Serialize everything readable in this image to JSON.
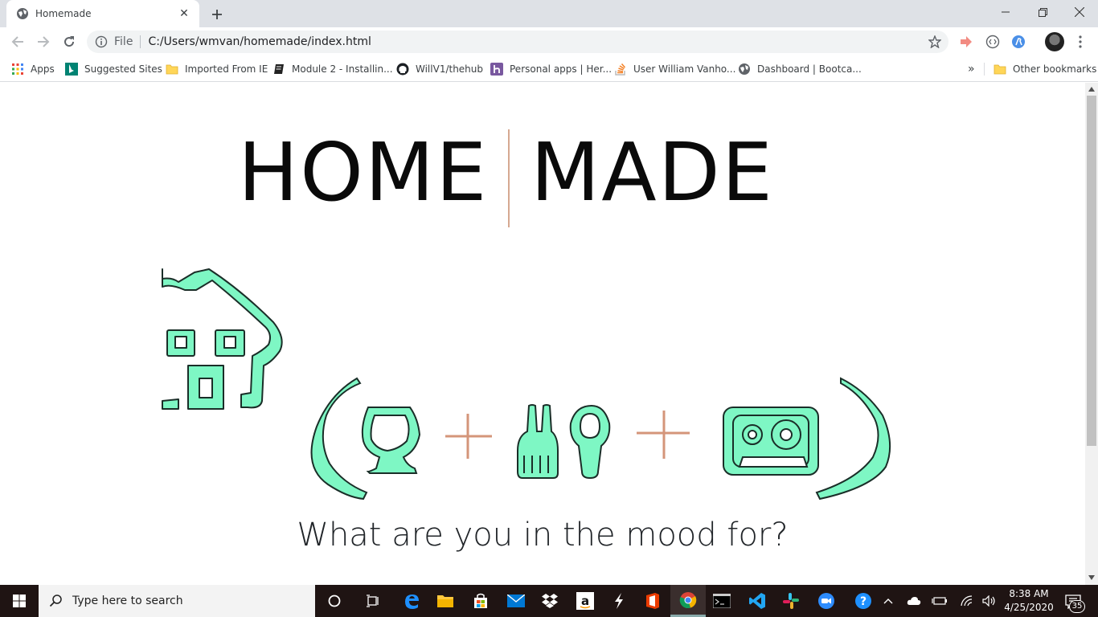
{
  "browser": {
    "tab_title": "Homemade",
    "new_tab_icon": "plus-icon",
    "url_scheme": "File",
    "url": "C:/Users/wmvan/homemade/index.html"
  },
  "bookmarks": [
    {
      "label": "Apps",
      "icon": "apps-grid-icon"
    },
    {
      "label": "Suggested Sites",
      "icon": "bing-icon"
    },
    {
      "label": "Imported From IE",
      "icon": "folder-icon"
    },
    {
      "label": "Module 2 - Installin...",
      "icon": "notebook-icon"
    },
    {
      "label": "WillV1/thehub",
      "icon": "github-icon"
    },
    {
      "label": "Personal apps | Her...",
      "icon": "heroku-icon"
    },
    {
      "label": "User William Vanho...",
      "icon": "stackoverflow-icon"
    },
    {
      "label": "Dashboard | Bootca...",
      "icon": "globe-icon"
    }
  ],
  "bookmarks_overflow": "»",
  "other_bookmarks": "Other bookmarks",
  "page": {
    "logo_left": "HOME",
    "logo_right": "MADE",
    "heading": "What are you in the mood for?",
    "colors": {
      "mint": "#7ef7c4",
      "outline": "#1a2e28",
      "plus": "#d4957a",
      "divider": "#d6a891"
    }
  },
  "taskbar": {
    "search_placeholder": "Type here to search",
    "time": "8:38 AM",
    "date": "4/25/2020",
    "notification_count": "35"
  }
}
